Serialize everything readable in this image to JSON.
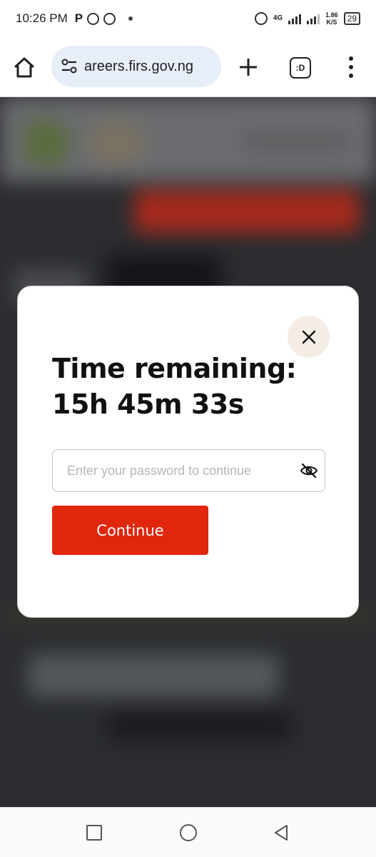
{
  "status_bar": {
    "time": "10:26 PM",
    "notification_icons": [
      "parking-p-icon",
      "whatsapp-icon",
      "whatsapp-icon",
      "dot-icon"
    ],
    "network_type": "4G",
    "speed_value": "1.86",
    "speed_unit": "K/S",
    "battery": "29"
  },
  "browser": {
    "url": "areers.firs.gov.ng",
    "tabs_label": ":D",
    "icons": {
      "home": "home-icon",
      "site_settings": "tune-icon",
      "new_tab": "plus-icon",
      "tabs": "tab-switcher-icon",
      "menu": "more-vertical-icon"
    }
  },
  "modal": {
    "title_line1": "Time remaining:",
    "title_line2": "15h 45m 33s",
    "password_placeholder": "Enter your password to continue",
    "password_value": "",
    "continue_label": "Continue",
    "accent_color": "#e0260d",
    "close_bg_color": "#f3ede5"
  },
  "nav_bar": {
    "icons": [
      "recent-apps-icon",
      "home-circle-icon",
      "back-triangle-icon"
    ]
  }
}
